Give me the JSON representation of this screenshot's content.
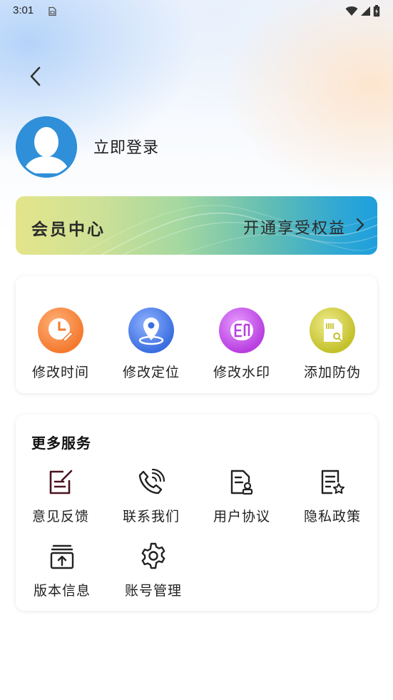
{
  "status_bar": {
    "time": "3:01"
  },
  "profile": {
    "login_text": "立即登录"
  },
  "vip": {
    "title": "会员中心",
    "cta": "开通享受权益"
  },
  "tools": [
    {
      "label": "修改时间",
      "icon": "clock-edit-icon",
      "color": "#f47a2f"
    },
    {
      "label": "修改定位",
      "icon": "location-pin-icon",
      "color": "#3b6fe0"
    },
    {
      "label": "修改水印",
      "icon": "watermark-stamp-icon",
      "color": "#b93fe0"
    },
    {
      "label": "添加防伪",
      "icon": "anti-fake-card-icon",
      "color": "#c4c12c"
    }
  ],
  "services": {
    "title": "更多服务",
    "items": [
      {
        "label": "意见反馈",
        "icon": "feedback-edit-icon"
      },
      {
        "label": "联系我们",
        "icon": "phone-call-icon"
      },
      {
        "label": "用户协议",
        "icon": "user-agreement-icon"
      },
      {
        "label": "隐私政策",
        "icon": "privacy-policy-icon"
      },
      {
        "label": "版本信息",
        "icon": "version-upload-icon"
      },
      {
        "label": "账号管理",
        "icon": "settings-gear-icon"
      }
    ]
  }
}
